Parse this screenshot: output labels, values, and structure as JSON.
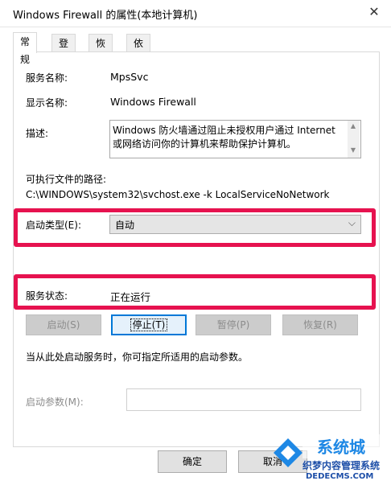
{
  "window": {
    "title": "Windows Firewall 的属性(本地计算机)",
    "close_glyph": "✕"
  },
  "tabs": [
    {
      "label": "常规",
      "active": true
    },
    {
      "label": "登录",
      "active": false
    },
    {
      "label": "恢复",
      "active": false
    },
    {
      "label": "依存关系",
      "active": false
    }
  ],
  "general": {
    "service_name_label": "服务名称:",
    "service_name": "MpsSvc",
    "display_name_label": "显示名称:",
    "display_name": "Windows Firewall",
    "description_label": "描述:",
    "description_line1": "Windows 防火墙通过阻止未授权用户通过 Internet",
    "description_line2": "或网络访问你的计算机来帮助保护计算机。",
    "path_label": "可执行文件的路径:",
    "path": "C:\\WINDOWS\\system32\\svchost.exe -k LocalServiceNoNetwork",
    "startup_type_label": "启动类型(E):",
    "startup_type": "自动",
    "status_label": "服务状态:",
    "status": "正在运行",
    "buttons": {
      "start": "启动(S)",
      "stop": "停止(T)",
      "pause": "暂停(P)",
      "resume": "恢复(R)"
    },
    "hint": "当从此处启动服务时，你可指定所适用的启动参数。",
    "params_label": "启动参数(M):",
    "params_value": ""
  },
  "footer": {
    "ok": "确定",
    "cancel": "取消"
  },
  "watermark": {
    "text1": "系统城",
    "text2": "织梦内容管理系统",
    "text3": "DEDECMS.COM"
  },
  "colors": {
    "highlight": "#e6124f",
    "accent": "#0078d7"
  }
}
